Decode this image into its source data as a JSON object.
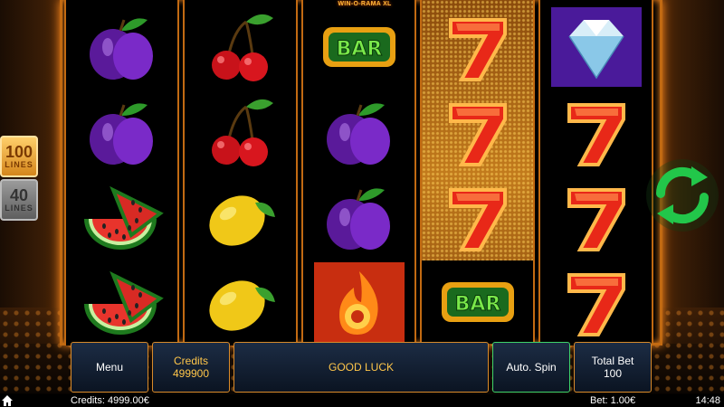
{
  "game": {
    "title": "WIN-O-RAMA XL"
  },
  "lines": {
    "active": {
      "number": "100",
      "label": "LINES"
    },
    "inactive": {
      "number": "40",
      "label": "LINES"
    }
  },
  "reels": [
    [
      "plum",
      "plum",
      "watermelon",
      "watermelon"
    ],
    [
      "cherry",
      "cherry",
      "lemon",
      "lemon"
    ],
    [
      "bar",
      "plum",
      "plum",
      "fire"
    ],
    [
      "seven",
      "seven",
      "seven",
      "bar"
    ],
    [
      "diamond",
      "seven",
      "seven",
      "seven"
    ]
  ],
  "symbol_text": {
    "bar": "BAR"
  },
  "controls": {
    "menu_label": "Menu",
    "credits_label": "Credits",
    "credits_value": "499900",
    "message": "GOOD LUCK",
    "autospin_label": "Auto. Spin",
    "totalbet_label": "Total Bet",
    "totalbet_value": "100"
  },
  "status": {
    "credits": "Credits: 4999.00€",
    "bet": "Bet: 1.00€",
    "time": "14:48"
  },
  "colors": {
    "frame": "#c26a12",
    "accent_gold": "#ffc64a",
    "spin_green": "#22c74a",
    "autospin_border": "#3fd36a"
  },
  "icons": {
    "spin": "refresh-arrows-icon",
    "home": "home-icon"
  }
}
